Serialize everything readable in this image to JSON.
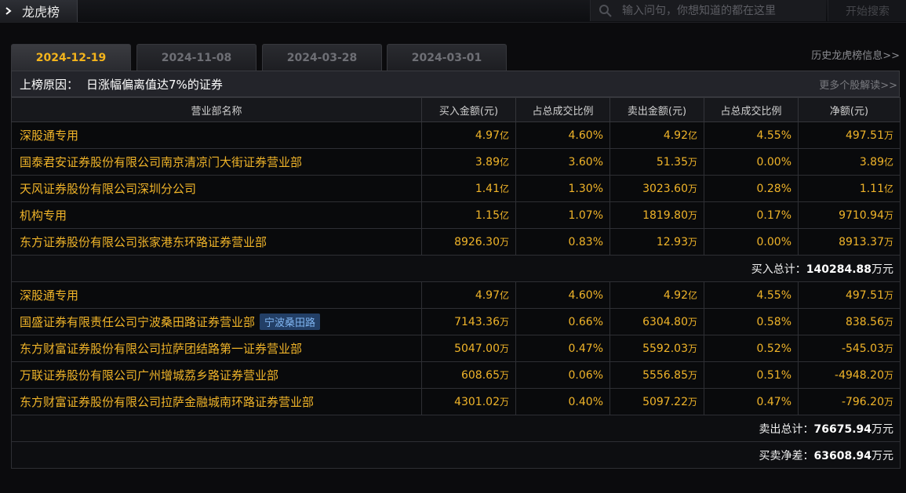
{
  "topbar": {
    "title": "龙虎榜",
    "search_placeholder": "输入问句，你想知道的都在这里",
    "search_button": "开始搜索"
  },
  "tabs": [
    "2024-12-19",
    "2024-11-08",
    "2024-03-28",
    "2024-03-01"
  ],
  "history_link": "历史龙虎榜信息>>",
  "reason": {
    "label": "上榜原因：",
    "value": "日涨幅偏离值达7%的证券",
    "more_link": "更多个股解读>>"
  },
  "columns": [
    "营业部名称",
    "买入金额(元)",
    "占总成交比例",
    "卖出金额(元)",
    "占总成交比例",
    "净额(元)"
  ],
  "buy_rows": [
    {
      "name": "深股通专用",
      "buy": "4.97",
      "buy_u": "亿",
      "buy_pct": "4.60%",
      "sell": "4.92",
      "sell_u": "亿",
      "sell_pct": "4.55%",
      "net": "497.51",
      "net_u": "万"
    },
    {
      "name": "国泰君安证券股份有限公司南京清凉门大街证券营业部",
      "buy": "3.89",
      "buy_u": "亿",
      "buy_pct": "3.60%",
      "sell": "51.35",
      "sell_u": "万",
      "sell_pct": "0.00%",
      "net": "3.89",
      "net_u": "亿"
    },
    {
      "name": "天风证券股份有限公司深圳分公司",
      "buy": "1.41",
      "buy_u": "亿",
      "buy_pct": "1.30%",
      "sell": "3023.60",
      "sell_u": "万",
      "sell_pct": "0.28%",
      "net": "1.11",
      "net_u": "亿"
    },
    {
      "name": "机构专用",
      "buy": "1.15",
      "buy_u": "亿",
      "buy_pct": "1.07%",
      "sell": "1819.80",
      "sell_u": "万",
      "sell_pct": "0.17%",
      "net": "9710.94",
      "net_u": "万"
    },
    {
      "name": "东方证券股份有限公司张家港东环路证券营业部",
      "buy": "8926.30",
      "buy_u": "万",
      "buy_pct": "0.83%",
      "sell": "12.93",
      "sell_u": "万",
      "sell_pct": "0.00%",
      "net": "8913.37",
      "net_u": "万"
    }
  ],
  "buy_total": {
    "label": "买入总计：",
    "value": "140284.88",
    "unit": "万元"
  },
  "sell_rows": [
    {
      "name": "深股通专用",
      "tag": "",
      "buy": "4.97",
      "buy_u": "亿",
      "buy_pct": "4.60%",
      "sell": "4.92",
      "sell_u": "亿",
      "sell_pct": "4.55%",
      "net": "497.51",
      "net_u": "万"
    },
    {
      "name": "国盛证券有限责任公司宁波桑田路证券营业部",
      "tag": "宁波桑田路",
      "buy": "7143.36",
      "buy_u": "万",
      "buy_pct": "0.66%",
      "sell": "6304.80",
      "sell_u": "万",
      "sell_pct": "0.58%",
      "net": "838.56",
      "net_u": "万"
    },
    {
      "name": "东方财富证券股份有限公司拉萨团结路第一证券营业部",
      "tag": "",
      "buy": "5047.00",
      "buy_u": "万",
      "buy_pct": "0.47%",
      "sell": "5592.03",
      "sell_u": "万",
      "sell_pct": "0.52%",
      "net": "-545.03",
      "net_u": "万"
    },
    {
      "name": "万联证券股份有限公司广州增城荔乡路证券营业部",
      "tag": "",
      "buy": "608.65",
      "buy_u": "万",
      "buy_pct": "0.06%",
      "sell": "5556.85",
      "sell_u": "万",
      "sell_pct": "0.51%",
      "net": "-4948.20",
      "net_u": "万"
    },
    {
      "name": "东方财富证券股份有限公司拉萨金融城南环路证券营业部",
      "tag": "",
      "buy": "4301.02",
      "buy_u": "万",
      "buy_pct": "0.40%",
      "sell": "5097.22",
      "sell_u": "万",
      "sell_pct": "0.47%",
      "net": "-796.20",
      "net_u": "万"
    }
  ],
  "sell_total": {
    "label": "卖出总计：",
    "value": "76675.94",
    "unit": "万元"
  },
  "net_total": {
    "label": "买卖净差：",
    "value": "63608.94",
    "unit": "万元"
  },
  "colors": {
    "accent": "#f0b429",
    "tag_bg": "#233f66",
    "tag_text": "#7fb4f0"
  }
}
